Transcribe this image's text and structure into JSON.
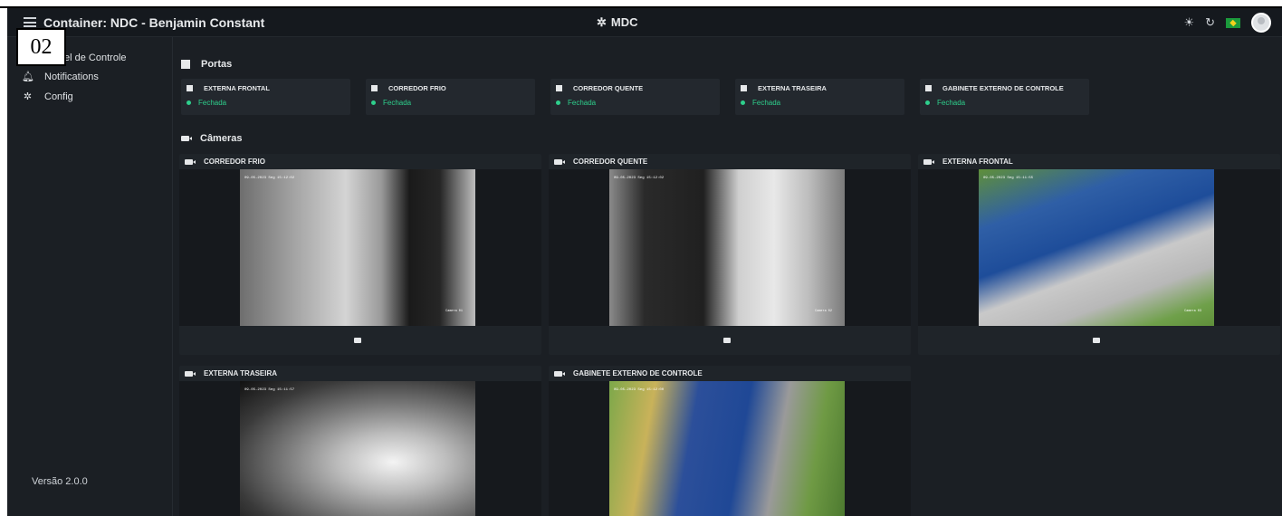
{
  "header": {
    "title": "Container: NDC - Benjamin Constant",
    "center_title": "MDC",
    "icons": [
      "sun-icon",
      "refresh-icon",
      "brazil-flag-icon",
      "user-avatar-icon"
    ]
  },
  "sidebar": {
    "items": [
      {
        "label": "Painel de Controle",
        "icon": "dashboard-icon"
      },
      {
        "label": "Notifications",
        "icon": "bell-icon"
      },
      {
        "label": "Config",
        "icon": "gear-icon"
      }
    ],
    "version": "Versão 2.0.0"
  },
  "stamp_label": "02",
  "portas": {
    "title": "Portas",
    "doors": [
      {
        "name": "EXTERNA FRONTAL",
        "status": "Fechada"
      },
      {
        "name": "CORREDOR FRIO",
        "status": "Fechada"
      },
      {
        "name": "CORREDOR QUENTE",
        "status": "Fechada"
      },
      {
        "name": "EXTERNA TRASEIRA",
        "status": "Fechada"
      },
      {
        "name": "GABINETE EXTERNO DE CONTROLE",
        "status": "Fechada"
      }
    ]
  },
  "cameras": {
    "title": "Câmeras",
    "items": [
      {
        "name": "CORREDOR FRIO",
        "osd": "09-05-2023 Seg 15:12:02",
        "label": "Camera 01"
      },
      {
        "name": "CORREDOR QUENTE",
        "osd": "09-05-2023 Seg 15:12:02",
        "label": "Camera 02"
      },
      {
        "name": "EXTERNA FRONTAL",
        "osd": "09-05-2023 Seg 15:11:55",
        "label": "Camera 03"
      },
      {
        "name": "EXTERNA TRASEIRA",
        "osd": "09-05-2023 Seg 15:11:57",
        "label": ""
      },
      {
        "name": "GABINETE EXTERNO DE CONTROLE",
        "osd": "09-05-2023 Seg 15:12:00",
        "label": ""
      }
    ]
  },
  "colors": {
    "accent_green": "#2ecf8c",
    "background": "#1b1f24",
    "card": "#23282e"
  }
}
